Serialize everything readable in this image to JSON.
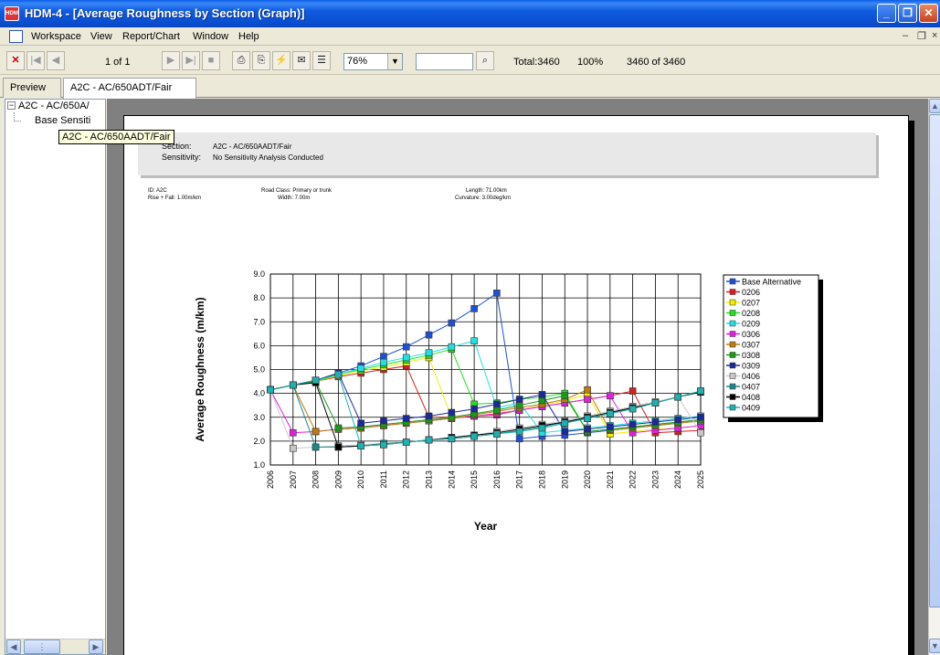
{
  "window": {
    "title": "HDM-4 - [Average Roughness by Section (Graph)]",
    "app_icon_text": "HDM"
  },
  "menu": [
    "Workspace",
    "View",
    "Report/Chart",
    "Window",
    "Help"
  ],
  "toolbar": {
    "page_indicator": "1 of 1",
    "zoom": "76%",
    "search_value": "",
    "total": "Total:3460",
    "percent": "100%",
    "count": "3460 of 3460"
  },
  "tabs": [
    "Preview",
    "A2C - AC/650ADT/Fair"
  ],
  "tree": {
    "root": "A2C - AC/650A/",
    "child": "Base Sensiti",
    "tooltip": "A2C - AC/650AADT/Fair"
  },
  "report": {
    "section_label": "Section:",
    "section_value": "A2C - AC/650AADT/Fair",
    "sensitivity_label": "Sensitivity:",
    "sensitivity_value": "No Sensitivity Analysis Conducted",
    "id": "ID:   A2C",
    "rise_fall": "Rise + Fall:  1.00m/km",
    "road_class": "Road Class:  Primary or trunk",
    "width": "Width:  7.00m",
    "length": "Length:  71.00km",
    "curvature": "Curvature: 3.00deg/km"
  },
  "colors": {
    "titlebar": "#0a4fd2",
    "window_bg": "#ece9d8",
    "preview_bg": "#808080"
  },
  "chart_data": {
    "type": "line",
    "title": "",
    "xlabel": "Year",
    "ylabel": "Average Roughness (m/km)",
    "x": [
      2006,
      2007,
      2008,
      2009,
      2010,
      2011,
      2012,
      2013,
      2014,
      2015,
      2016,
      2017,
      2018,
      2019,
      2020,
      2021,
      2022,
      2023,
      2024,
      2025
    ],
    "ylim": [
      1.0,
      9.0
    ],
    "yticks": [
      "1.0",
      "2.0",
      "3.0",
      "4.0",
      "5.0",
      "6.0",
      "7.0",
      "8.0",
      "9.0"
    ],
    "grid": true,
    "legend_position": "right",
    "series": [
      {
        "name": "Base Alternative",
        "color": "#1f4fd8",
        "values": [
          4.15,
          4.35,
          4.55,
          4.85,
          5.15,
          5.55,
          5.95,
          6.45,
          6.95,
          7.55,
          8.2,
          2.1,
          2.2,
          2.25,
          2.35,
          2.45,
          2.55,
          2.65,
          2.75,
          2.85
        ]
      },
      {
        "name": "0206",
        "color": "#d81e1e",
        "values": [
          4.15,
          4.35,
          4.5,
          4.7,
          4.85,
          5.0,
          5.15,
          3.0,
          3.0,
          3.05,
          3.1,
          3.3,
          3.45,
          3.6,
          3.75,
          3.9,
          4.1,
          2.35,
          2.4,
          2.45
        ]
      },
      {
        "name": "0207",
        "color": "#f0f000",
        "values": [
          4.15,
          4.35,
          4.5,
          4.75,
          4.95,
          5.1,
          5.3,
          5.5,
          3.0,
          3.05,
          3.15,
          3.3,
          3.5,
          3.7,
          3.95,
          2.3,
          2.4,
          2.5,
          2.55,
          2.65
        ]
      },
      {
        "name": "0208",
        "color": "#22e022",
        "values": [
          4.15,
          4.35,
          4.5,
          4.8,
          5.0,
          5.2,
          5.4,
          5.6,
          5.85,
          3.55,
          3.6,
          3.75,
          3.85,
          4.0,
          2.4,
          2.5,
          2.6,
          2.7,
          2.8,
          2.9
        ]
      },
      {
        "name": "0209",
        "color": "#22e0e0",
        "values": [
          4.15,
          4.35,
          4.55,
          4.8,
          5.05,
          5.3,
          5.5,
          5.7,
          5.95,
          6.2,
          3.4,
          3.6,
          2.35,
          2.45,
          2.55,
          2.65,
          2.75,
          2.85,
          2.95,
          3.05
        ]
      },
      {
        "name": "0306",
        "color": "#e020e0",
        "values": [
          4.15,
          2.35,
          2.4,
          2.5,
          2.55,
          2.65,
          2.75,
          2.85,
          2.95,
          3.05,
          3.15,
          3.3,
          3.45,
          3.6,
          3.75,
          3.9,
          2.35,
          2.45,
          2.55,
          2.65
        ]
      },
      {
        "name": "0307",
        "color": "#c07a10",
        "values": [
          4.15,
          4.35,
          2.4,
          2.5,
          2.55,
          2.65,
          2.75,
          2.85,
          2.95,
          3.1,
          3.25,
          3.4,
          3.55,
          3.75,
          4.15,
          2.45,
          2.55,
          2.65,
          2.75,
          2.85
        ]
      },
      {
        "name": "0308",
        "color": "#1a9a1a",
        "values": [
          4.15,
          4.35,
          4.5,
          2.55,
          2.6,
          2.7,
          2.8,
          2.9,
          3.0,
          3.15,
          3.3,
          3.5,
          3.7,
          3.9,
          2.4,
          2.5,
          2.6,
          2.7,
          2.8,
          2.9
        ]
      },
      {
        "name": "0309",
        "color": "#1a2a9a",
        "values": [
          4.15,
          4.35,
          4.55,
          4.85,
          2.75,
          2.85,
          2.95,
          3.05,
          3.2,
          3.35,
          3.55,
          3.75,
          3.95,
          2.4,
          2.5,
          2.6,
          2.7,
          2.8,
          2.9,
          3.0
        ]
      },
      {
        "name": "0406",
        "color": "#c8c8c8",
        "values": [
          4.15,
          1.7,
          1.75,
          1.8,
          1.85,
          1.9,
          1.95,
          2.05,
          2.15,
          2.25,
          2.4,
          2.55,
          2.7,
          2.85,
          3.05,
          3.25,
          3.45,
          3.65,
          3.85,
          2.35
        ]
      },
      {
        "name": "0407",
        "color": "#1a8a8a",
        "values": [
          4.15,
          4.35,
          1.75,
          1.75,
          1.8,
          1.9,
          1.95,
          2.05,
          2.1,
          2.2,
          2.3,
          2.45,
          2.6,
          2.8,
          2.95,
          3.15,
          3.4,
          3.6,
          3.85,
          4.1
        ]
      },
      {
        "name": "0408",
        "color": "#000000",
        "values": [
          4.15,
          4.35,
          4.45,
          1.75,
          1.8,
          1.85,
          1.95,
          2.05,
          2.15,
          2.25,
          2.35,
          2.5,
          2.65,
          2.8,
          3.0,
          3.2,
          3.4,
          3.6,
          3.85,
          4.05
        ]
      },
      {
        "name": "0409",
        "color": "#20b0b0",
        "values": [
          4.15,
          4.35,
          4.55,
          4.8,
          1.8,
          1.85,
          1.95,
          2.05,
          2.1,
          2.2,
          2.3,
          2.4,
          2.55,
          2.75,
          2.95,
          3.15,
          3.35,
          3.6,
          3.85,
          4.1
        ]
      }
    ]
  }
}
